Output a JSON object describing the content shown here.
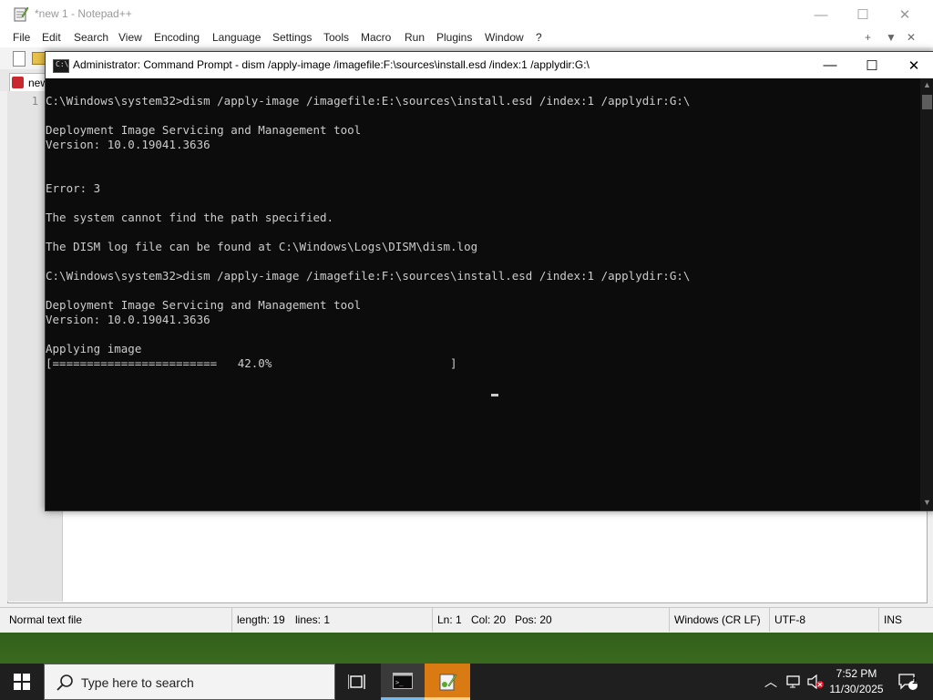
{
  "notepad": {
    "title": "*new 1 - Notepad++",
    "menu": [
      "File",
      "Edit",
      "Search",
      "View",
      "Encoding",
      "Language",
      "Settings",
      "Tools",
      "Macro",
      "Run",
      "Plugins",
      "Window",
      "?"
    ],
    "menu_right": [
      "+",
      "▼",
      "✕"
    ],
    "tab_label": "new",
    "line_number": "1",
    "status": {
      "file_type": "Normal text file",
      "length": "length: 19",
      "lines": "lines: 1",
      "ln": "Ln: 1",
      "col": "Col: 20",
      "pos": "Pos: 20",
      "eol": "Windows (CR LF)",
      "encoding": "UTF-8",
      "mode": "INS"
    }
  },
  "cmd": {
    "title": "Administrator: Command Prompt - dism /apply-image /imagefile:F:\\sources\\install.esd /index:1 /applydir:G:\\",
    "icon_text": "C:\\",
    "lines": [
      "C:\\Windows\\system32>dism /apply-image /imagefile:E:\\sources\\install.esd /index:1 /applydir:G:\\",
      "",
      "Deployment Image Servicing and Management tool",
      "Version: 10.0.19041.3636",
      "",
      "",
      "Error: 3",
      "",
      "The system cannot find the path specified.",
      "",
      "The DISM log file can be found at C:\\Windows\\Logs\\DISM\\dism.log",
      "",
      "C:\\Windows\\system32>dism /apply-image /imagefile:F:\\sources\\install.esd /index:1 /applydir:G:\\",
      "",
      "Deployment Image Servicing and Management tool",
      "Version: 10.0.19041.3636",
      "",
      "Applying image",
      "[========================   42.0%                          ]"
    ],
    "progress_percent": 42.0
  },
  "taskbar": {
    "search_placeholder": "Type here to search",
    "time": "7:52 PM",
    "date": "11/30/2025",
    "notification_count": "1"
  }
}
